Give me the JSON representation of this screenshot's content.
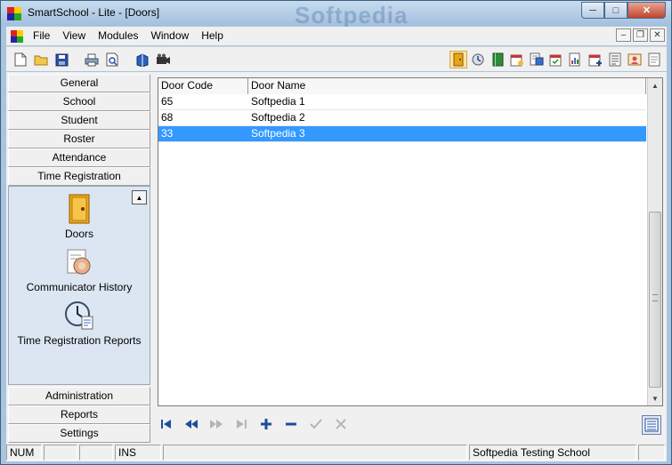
{
  "window": {
    "title": "SmartSchool - Lite - [Doors]",
    "watermark": "Softpedia"
  },
  "menu": {
    "items": [
      "File",
      "View",
      "Modules",
      "Window",
      "Help"
    ]
  },
  "toolbar": {
    "left_icons": [
      "new-file-icon",
      "open-folder-icon",
      "save-icon",
      "print-icon",
      "print-preview-icon",
      "book-icon",
      "camera-icon"
    ],
    "right_icons": [
      "door-icon",
      "communicator-icon",
      "book-green-icon",
      "calendar-icon",
      "report-icon",
      "calendar-check-icon",
      "report-chart-icon",
      "calendar-add-icon",
      "report-list-icon",
      "id-card-icon",
      "notepad-icon"
    ]
  },
  "nav": {
    "top_buttons": [
      "General",
      "School",
      "Student",
      "Roster",
      "Attendance",
      "Time Registration"
    ],
    "tiles": [
      "Doors",
      "Communicator History",
      "Time Registration Reports"
    ],
    "bottom_buttons": [
      "Administration",
      "Reports",
      "Settings"
    ]
  },
  "grid": {
    "columns": [
      "Door Code",
      "Door Name"
    ],
    "rows": [
      {
        "code": "65",
        "name": "Softpedia 1"
      },
      {
        "code": "68",
        "name": "Softpedia 2"
      },
      {
        "code": "33",
        "name": "Softpedia 3"
      }
    ],
    "selected_row": 2
  },
  "statusbar": {
    "num": "NUM",
    "blank1": "",
    "blank2": "",
    "ins": "INS",
    "blank3": "",
    "school": "Softpedia Testing School",
    "blank4": ""
  },
  "colors": {
    "selection": "#3399ff",
    "nav_panel": "#dce6f2",
    "navigator_active": "#1f4d9c"
  }
}
